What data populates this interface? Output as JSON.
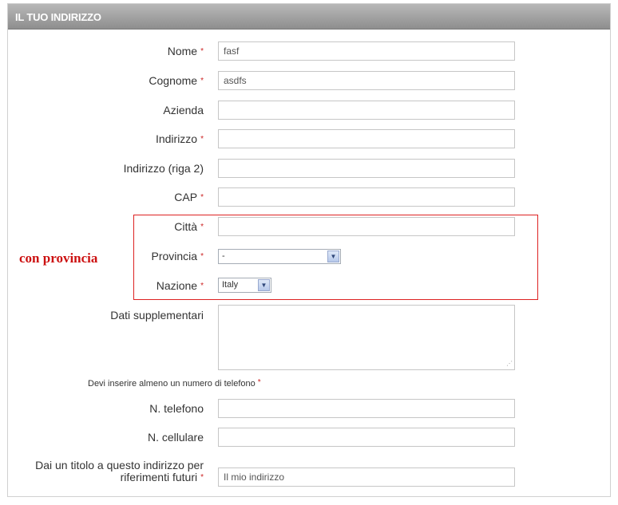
{
  "panel": {
    "title": "IL TUO INDIRIZZO"
  },
  "form": {
    "required_mark": "*",
    "nome": {
      "label": "Nome",
      "value": "fasf"
    },
    "cognome": {
      "label": "Cognome",
      "value": "asdfs"
    },
    "azienda": {
      "label": "Azienda",
      "value": ""
    },
    "indirizzo": {
      "label": "Indirizzo",
      "value": ""
    },
    "indirizzo2": {
      "label": "Indirizzo (riga 2)",
      "value": ""
    },
    "cap": {
      "label": "CAP",
      "value": ""
    },
    "citta": {
      "label": "Città",
      "value": ""
    },
    "provincia": {
      "label": "Provincia",
      "selected": "-"
    },
    "nazione": {
      "label": "Nazione",
      "selected": "Italy"
    },
    "dati": {
      "label": "Dati supplementari",
      "value": ""
    },
    "phone_note": "Devi inserire almeno un numero di telefono",
    "telefono": {
      "label": "N. telefono",
      "value": ""
    },
    "cellulare": {
      "label": "N. cellulare",
      "value": ""
    },
    "alias": {
      "label_line1": "Dai un titolo a questo indirizzo per",
      "label_line2": "riferimenti futuri",
      "value": "Il mio indirizzo"
    }
  },
  "annotation": {
    "text": "con provincia",
    "color": "#cc1111"
  },
  "icons": {
    "dropdown": "chevron-down-icon",
    "resize": "resize-grip-icon"
  }
}
